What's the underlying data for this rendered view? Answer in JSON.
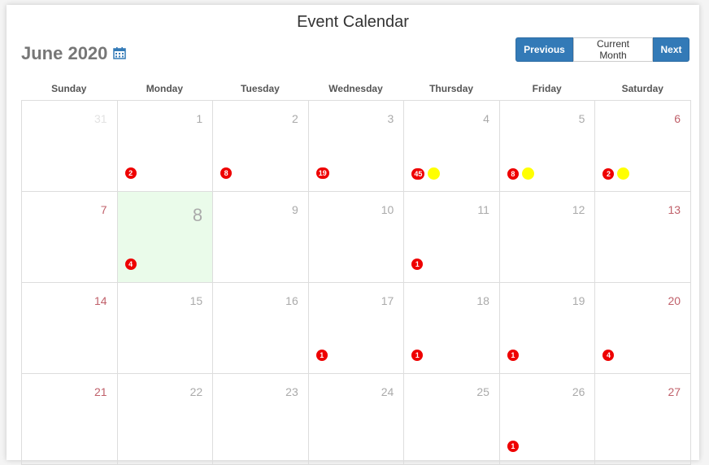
{
  "calendar": {
    "title": "Event Calendar",
    "month_label": "June 2020",
    "buttons": {
      "previous": "Previous",
      "current": "Current Month",
      "next": "Next"
    },
    "weekdays": [
      "Sunday",
      "Monday",
      "Tuesday",
      "Wednesday",
      "Thursday",
      "Friday",
      "Saturday"
    ],
    "colors": {
      "accent": "#337ab7",
      "badge": "#ee0000",
      "marker": "#ffff00",
      "today_bg": "#eafbea",
      "weekend_text": "#c0606a"
    },
    "weeks": [
      [
        {
          "day": "31",
          "other": true
        },
        {
          "day": "1",
          "badge": "2"
        },
        {
          "day": "2",
          "badge": "8"
        },
        {
          "day": "3",
          "badge": "19"
        },
        {
          "day": "4",
          "badge": "45",
          "dot": true
        },
        {
          "day": "5",
          "badge": "8",
          "dot": true
        },
        {
          "day": "6",
          "badge": "2",
          "dot": true
        }
      ],
      [
        {
          "day": "7"
        },
        {
          "day": "8",
          "badge": "4",
          "today": true
        },
        {
          "day": "9"
        },
        {
          "day": "10"
        },
        {
          "day": "11",
          "badge": "1"
        },
        {
          "day": "12"
        },
        {
          "day": "13"
        }
      ],
      [
        {
          "day": "14"
        },
        {
          "day": "15"
        },
        {
          "day": "16"
        },
        {
          "day": "17",
          "badge": "1"
        },
        {
          "day": "18",
          "badge": "1"
        },
        {
          "day": "19",
          "badge": "1"
        },
        {
          "day": "20",
          "badge": "4"
        }
      ],
      [
        {
          "day": "21"
        },
        {
          "day": "22"
        },
        {
          "day": "23"
        },
        {
          "day": "24"
        },
        {
          "day": "25"
        },
        {
          "day": "26",
          "badge": "1"
        },
        {
          "day": "27"
        }
      ]
    ]
  }
}
